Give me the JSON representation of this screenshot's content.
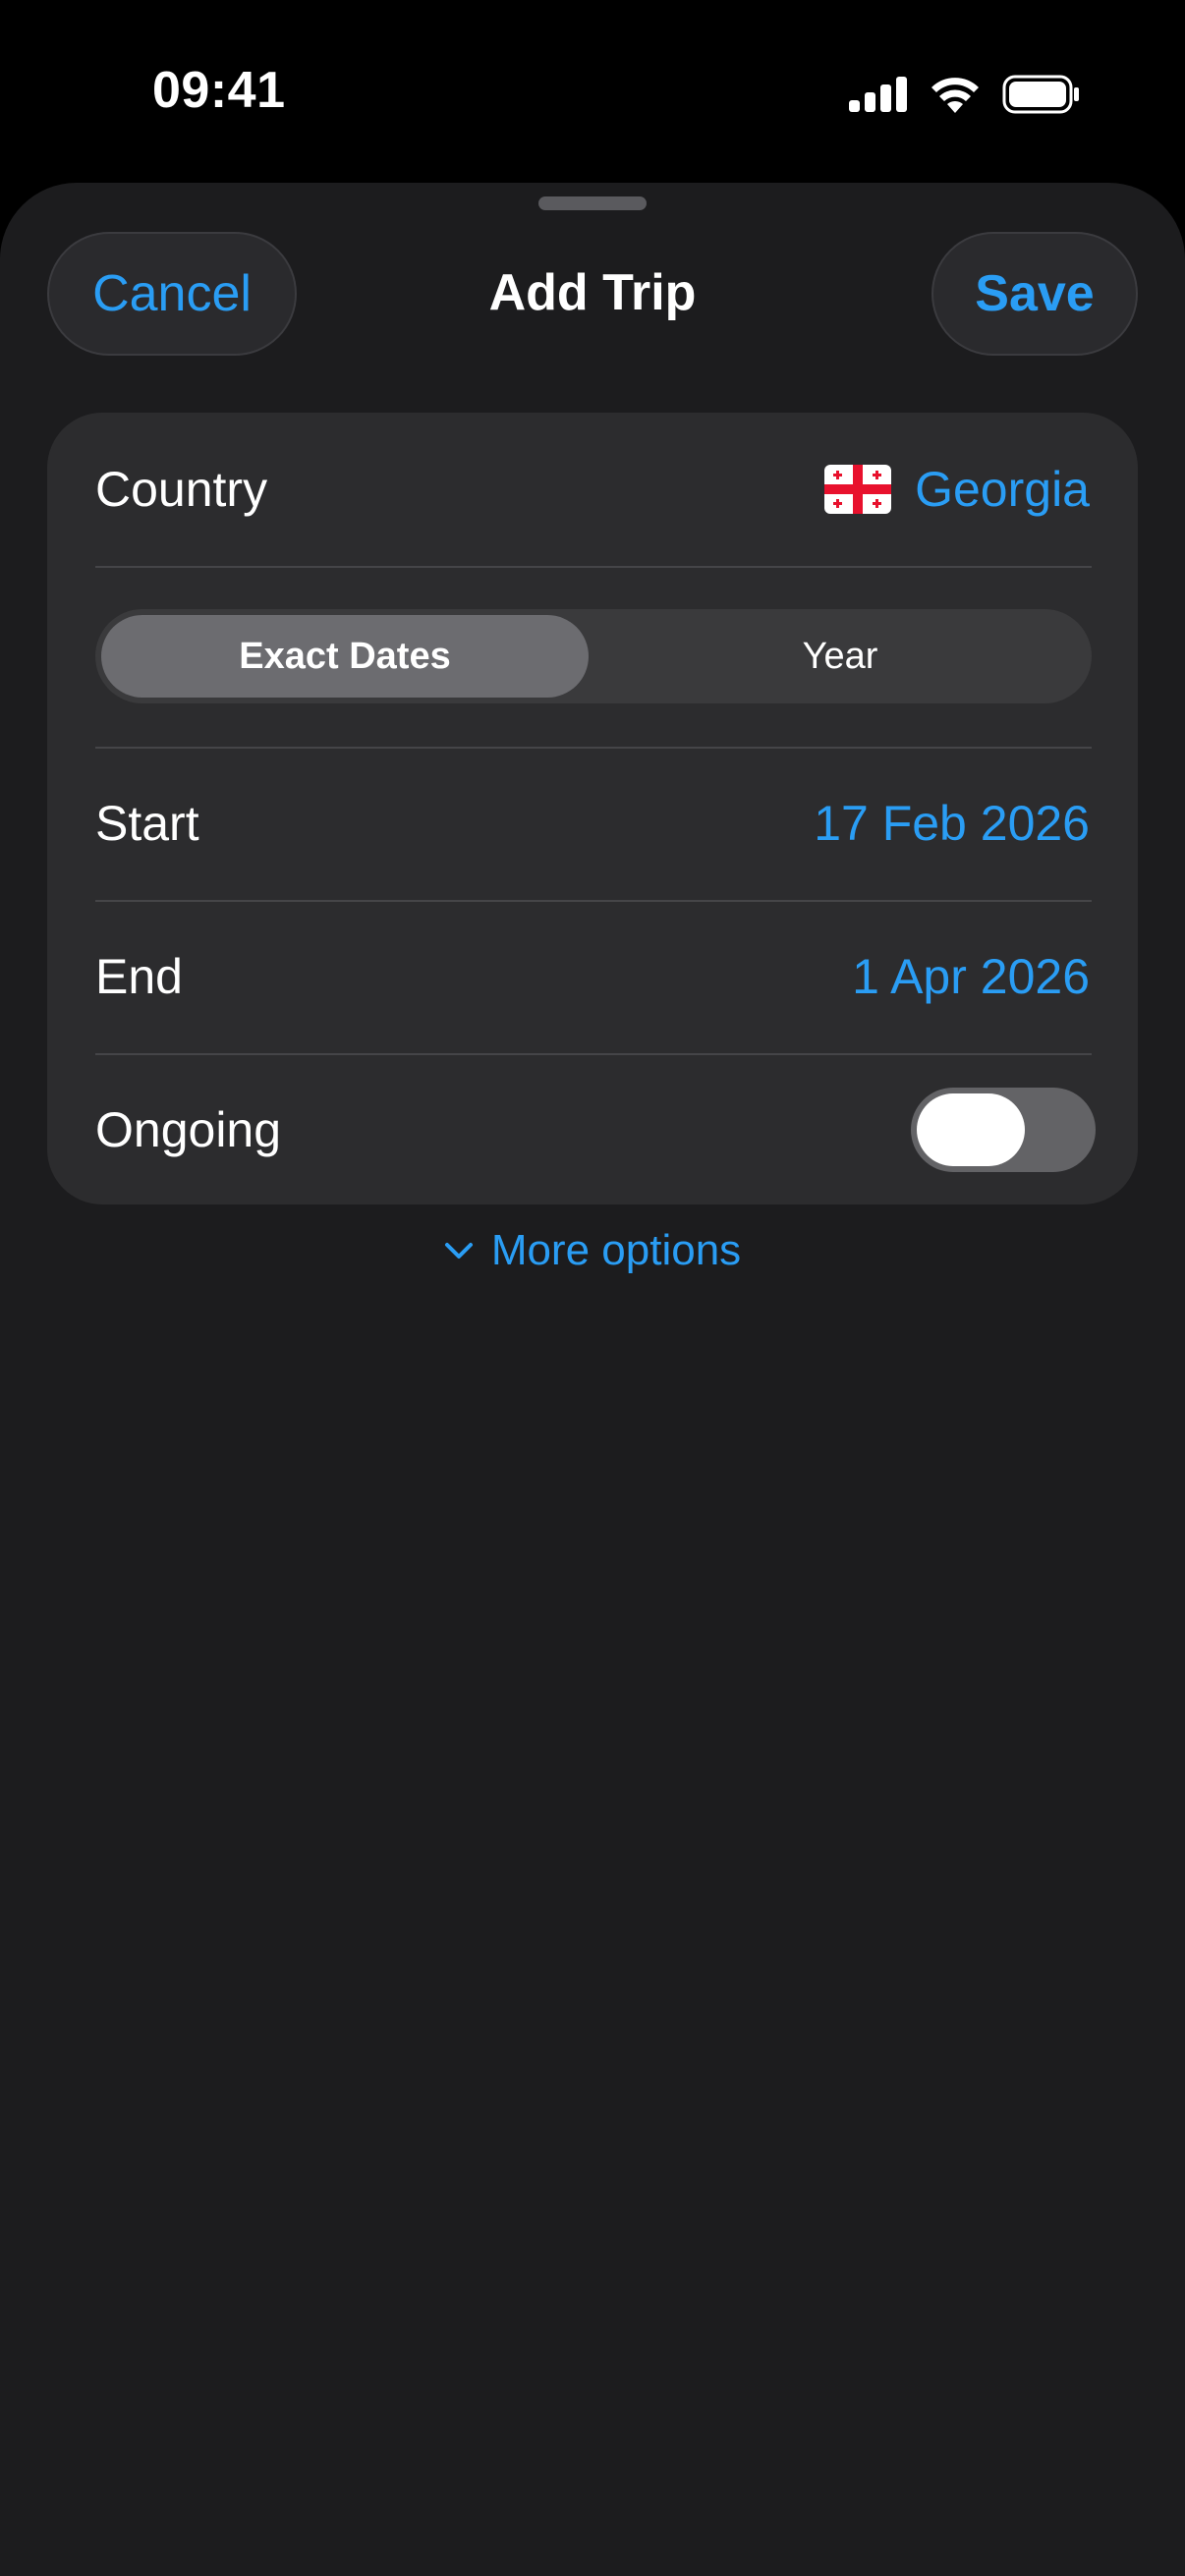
{
  "status_bar": {
    "time": "09:41",
    "icons": [
      "cellular-signal-icon",
      "wifi-icon",
      "battery-icon"
    ]
  },
  "header": {
    "title": "Add Trip",
    "cancel_label": "Cancel",
    "save_label": "Save"
  },
  "form": {
    "country": {
      "label": "Country",
      "value": "Georgia",
      "flag_icon": "georgia-flag-icon"
    },
    "date_mode": {
      "options": [
        "Exact Dates",
        "Year"
      ],
      "selected": "Exact Dates"
    },
    "start": {
      "label": "Start",
      "value": "17 Feb 2026"
    },
    "end": {
      "label": "End",
      "value": "1 Apr 2026"
    },
    "ongoing": {
      "label": "Ongoing",
      "enabled": false
    }
  },
  "more_options": {
    "label": "More options",
    "icon": "chevron-down-icon"
  },
  "colors": {
    "accent": "#2a9df4",
    "background": "#1c1c1e",
    "card": "#2c2c2e"
  }
}
